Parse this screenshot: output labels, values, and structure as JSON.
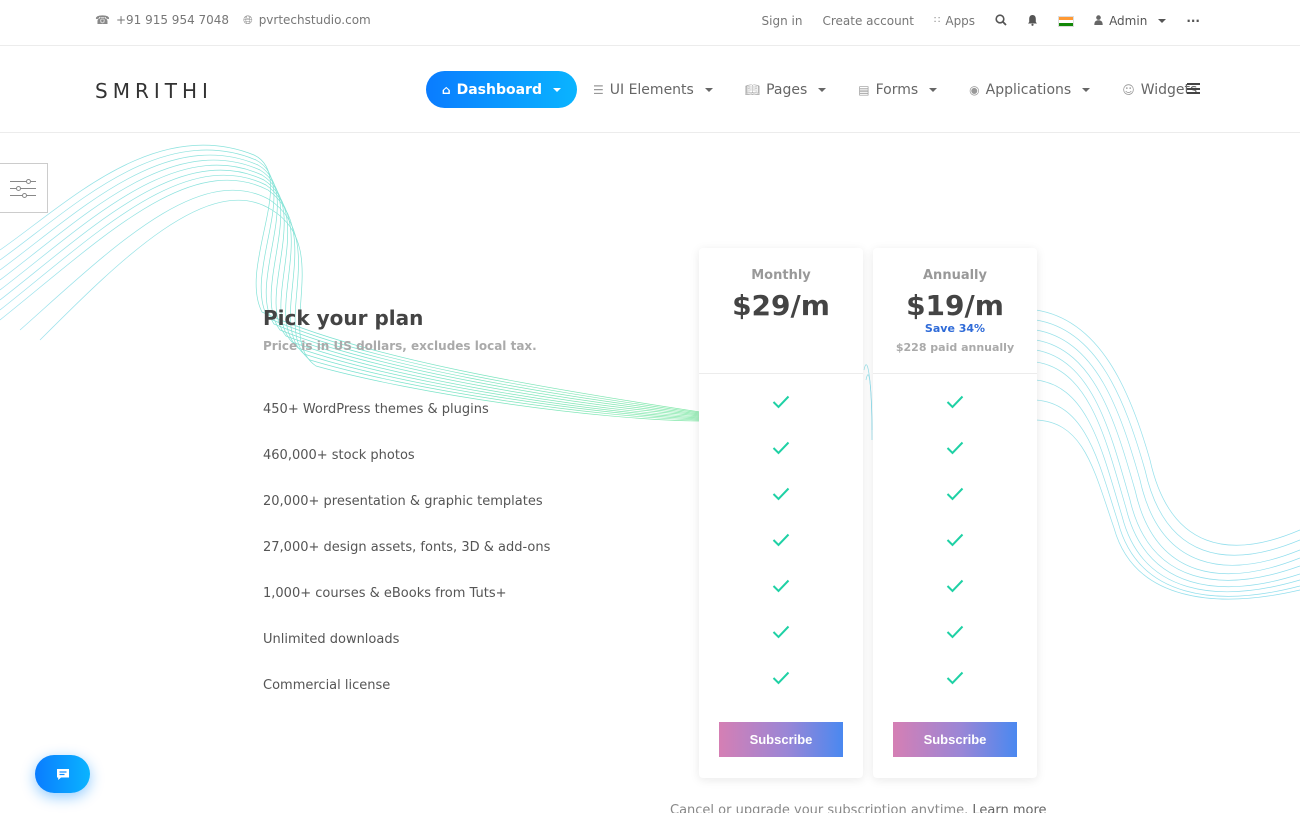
{
  "topbar": {
    "phone": "+91 915 954 7048",
    "website": "pvrtechstudio.com",
    "sign_in": "Sign in",
    "create_account": "Create account",
    "apps": "Apps",
    "admin": "Admin"
  },
  "brand": "SMRITHI",
  "nav": {
    "dashboard": "Dashboard",
    "ui_elements": "UI Elements",
    "pages": "Pages",
    "forms": "Forms",
    "applications": "Applications",
    "widgets": "Widgets"
  },
  "pricing": {
    "title": "Pick your plan",
    "subtitle": "Price is in US dollars, excludes local tax.",
    "features": [
      "450+ WordPress themes & plugins",
      "460,000+ stock photos",
      "20,000+ presentation & graphic templates",
      "27,000+ design assets, fonts, 3D & add-ons",
      "1,000+ courses & eBooks from Tuts+",
      "Unlimited downloads",
      "Commercial license"
    ],
    "plans": [
      {
        "name": "Monthly",
        "price": "$29/m",
        "save": "",
        "paid": "",
        "subscribe": "Subscribe"
      },
      {
        "name": "Annually",
        "price": "$19/m",
        "save": "Save 34%",
        "paid": "$228 paid annually",
        "subscribe": "Subscribe"
      }
    ],
    "footer_text": "Cancel or upgrade your subscription anytime.",
    "footer_link": "Learn more"
  },
  "colors": {
    "primary": "#0a7cff",
    "check": "#1fd1a5",
    "save": "#2f6bd8"
  }
}
